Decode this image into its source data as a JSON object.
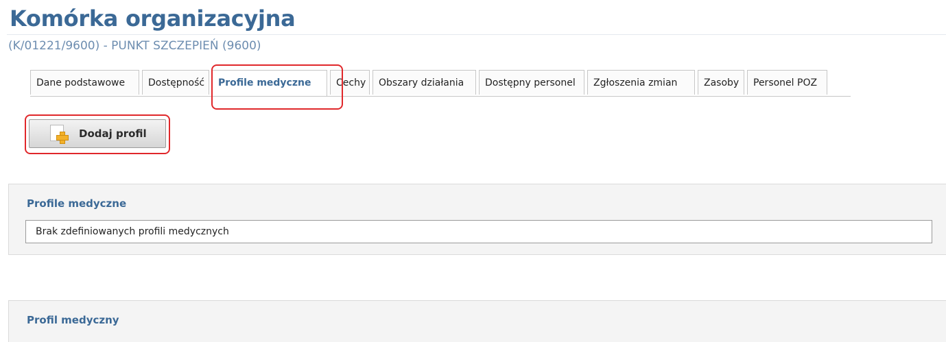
{
  "header": {
    "title": "Komórka organizacyjna",
    "subtitle": "(K/01221/9600) - PUNKT SZCZEPIEŃ (9600)"
  },
  "tabs": [
    {
      "label": "Dane podstawowe",
      "active": false
    },
    {
      "label": "Dostępność",
      "active": false
    },
    {
      "label": "Profile medyczne",
      "active": true
    },
    {
      "label": "Cechy",
      "active": false
    },
    {
      "label": "Obszary działania",
      "active": false
    },
    {
      "label": "Dostępny personel",
      "active": false
    },
    {
      "label": "Zgłoszenia zmian",
      "active": false
    },
    {
      "label": "Zasoby",
      "active": false
    },
    {
      "label": "Personel POZ",
      "active": false
    }
  ],
  "toolbar": {
    "add_profile_label": "Dodaj profil",
    "add_profile_icon": "document-add-icon"
  },
  "sections": {
    "profiles": {
      "title": "Profile medyczne",
      "empty_text": "Brak zdefiniowanych profili medycznych"
    },
    "profile": {
      "title": "Profil medyczny"
    }
  },
  "colors": {
    "accent": "#3b6996",
    "highlight": "#e0272a",
    "panel_bg": "#f4f4f4"
  }
}
